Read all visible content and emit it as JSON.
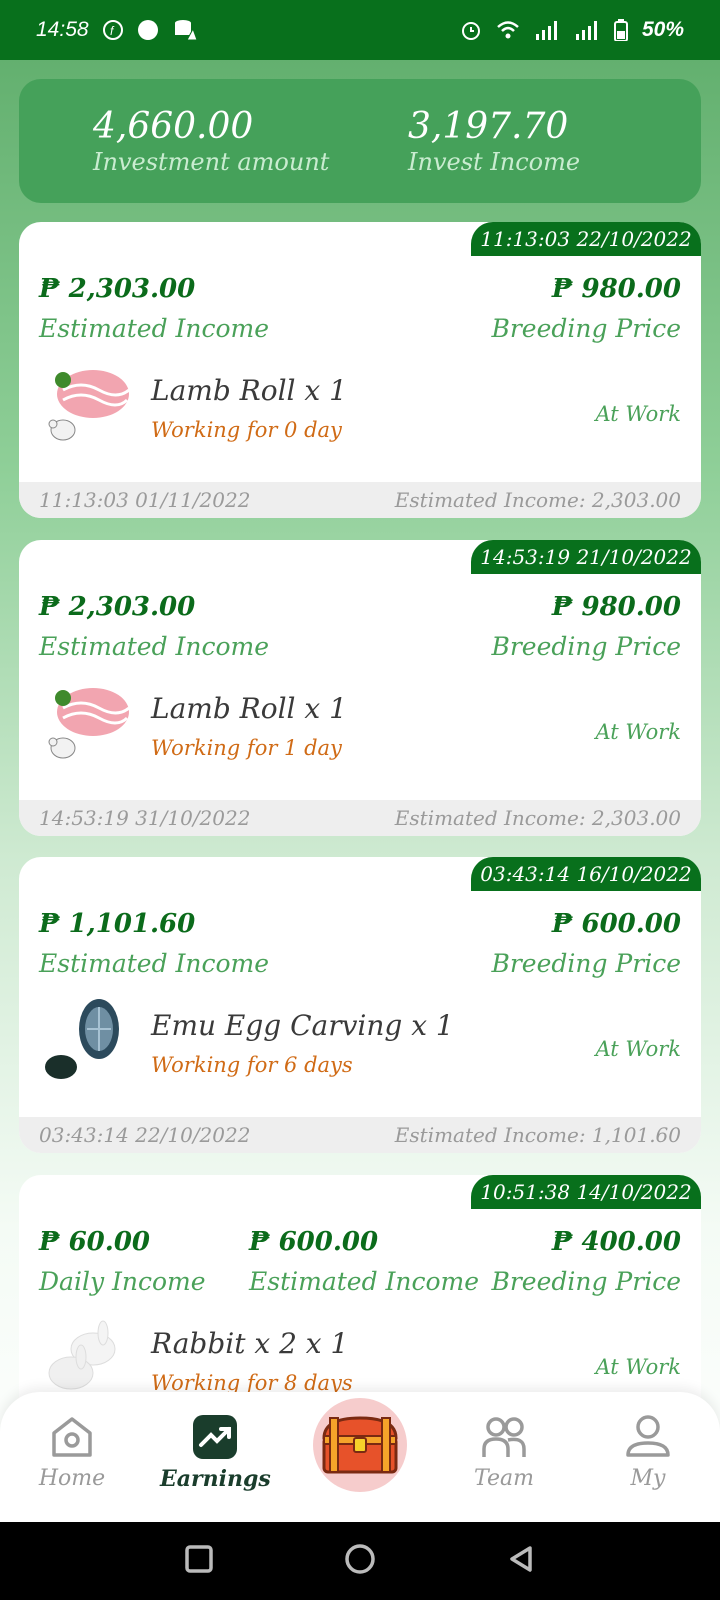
{
  "status_bar": {
    "time": "14:58",
    "battery": "50%"
  },
  "summary": {
    "investment_amount": "4,660.00",
    "investment_label": "Investment amount",
    "invest_income": "3,197.70",
    "invest_income_label": "Invest Income"
  },
  "cards": [
    {
      "timestamp": "11:13:03 22/10/2022",
      "money_left": "₱ 2,303.00",
      "money_left_label": "Estimated Income",
      "money_right": "₱ 980.00",
      "money_right_label": "Breeding Price",
      "product": "Lamb Roll x 1",
      "working": "Working for 0 day",
      "status": "At Work",
      "foot_left": "11:13:03 01/11/2022",
      "foot_right": "Estimated Income: 2,303.00",
      "thumb_icon": "lamb-roll-image"
    },
    {
      "timestamp": "14:53:19 21/10/2022",
      "money_left": "₱ 2,303.00",
      "money_left_label": "Estimated Income",
      "money_right": "₱ 980.00",
      "money_right_label": "Breeding Price",
      "product": "Lamb Roll x 1",
      "working": "Working for 1 day",
      "status": "At Work",
      "foot_left": "14:53:19 31/10/2022",
      "foot_right": "Estimated Income: 2,303.00",
      "thumb_icon": "lamb-roll-image"
    },
    {
      "timestamp": "03:43:14 16/10/2022",
      "money_left": "₱ 1,101.60",
      "money_left_label": "Estimated Income",
      "money_right": "₱ 600.00",
      "money_right_label": "Breeding Price",
      "product": "Emu Egg Carving x 1",
      "working": "Working for 6 days",
      "status": "At Work",
      "foot_left": "03:43:14 22/10/2022",
      "foot_right": "Estimated Income: 1,101.60",
      "thumb_icon": "emu-egg-image"
    },
    {
      "timestamp": "10:51:38 14/10/2022",
      "money_left": "₱ 60.00",
      "money_left_label": "Daily Income",
      "money_mid": "₱ 600.00",
      "money_mid_label": "Estimated Income",
      "money_right": "₱ 400.00",
      "money_right_label": "Breeding Price",
      "product": "Rabbit x 2 x 1",
      "working": "Working for 8 days",
      "status": "At Work",
      "thumb_icon": "rabbit-image"
    }
  ],
  "nav": {
    "home": "Home",
    "earnings": "Earnings",
    "team": "Team",
    "my": "My"
  },
  "colors": {
    "primary_green": "#08701c",
    "accent_green": "#4aa159",
    "working_orange": "#d06b16"
  }
}
